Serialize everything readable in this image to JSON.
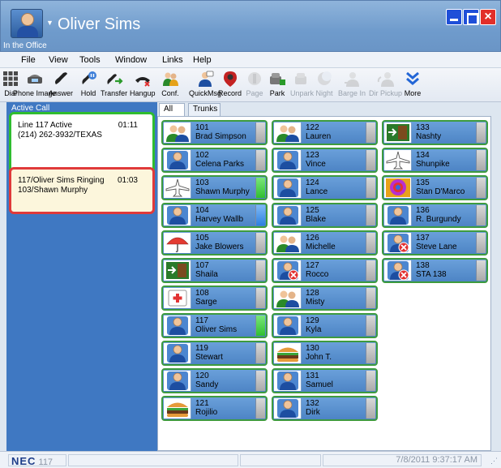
{
  "window": {
    "user_name": "Oliver Sims",
    "presence": "In the Office"
  },
  "menu": [
    "File",
    "View",
    "Tools",
    "Window",
    "Links",
    "Help"
  ],
  "toolbar": [
    {
      "label": "Dial",
      "icon": "dial-icon",
      "enabled": true
    },
    {
      "label": "Phone Image",
      "icon": "phone-image-icon",
      "enabled": true
    },
    {
      "label": "Answer",
      "icon": "answer-icon",
      "enabled": true
    },
    {
      "label": "Hold",
      "icon": "hold-icon",
      "enabled": true
    },
    {
      "label": "Transfer",
      "icon": "transfer-icon",
      "enabled": true
    },
    {
      "label": "Hangup",
      "icon": "hangup-icon",
      "enabled": true
    },
    {
      "label": "Conf.",
      "icon": "conference-icon",
      "enabled": true
    },
    {
      "label": "QuickMsg",
      "icon": "quickmsg-icon",
      "enabled": true
    },
    {
      "label": "Record",
      "icon": "record-icon",
      "enabled": true
    },
    {
      "label": "Page",
      "icon": "page-icon",
      "enabled": false
    },
    {
      "label": "Park",
      "icon": "park-icon",
      "enabled": true
    },
    {
      "label": "Unpark",
      "icon": "unpark-icon",
      "enabled": false
    },
    {
      "label": "Night",
      "icon": "night-icon",
      "enabled": false
    },
    {
      "label": "Barge In",
      "icon": "barge-in-icon",
      "enabled": false
    },
    {
      "label": "Dir Pickup",
      "icon": "dir-pickup-icon",
      "enabled": false
    },
    {
      "label": "More",
      "icon": "more-icon",
      "enabled": true
    }
  ],
  "active_call": {
    "legend": "Active Call",
    "line": "Line 117 Active",
    "number": "(214) 262-3932/TEXAS",
    "time": "01:11"
  },
  "ringing_call": {
    "line": "117/Oliver Sims  Ringing",
    "caller": "103/Shawn Murphy",
    "time": "01:03"
  },
  "tabs": [
    "All",
    "Trunks"
  ],
  "extensions": [
    {
      "num": "101",
      "name": "Brad Simpson",
      "icon": "group-icon",
      "led": "gray"
    },
    {
      "num": "102",
      "name": "Celena Parks",
      "icon": "user-icon",
      "led": "gray"
    },
    {
      "num": "103",
      "name": "Shawn Murphy",
      "icon": "airplane-icon",
      "led": "green"
    },
    {
      "num": "104",
      "name": "Harvey Wallb",
      "icon": "user-icon",
      "led": "blue"
    },
    {
      "num": "105",
      "name": "Jake Blowers",
      "icon": "umbrella-icon",
      "led": "gray"
    },
    {
      "num": "107",
      "name": "Shaila",
      "icon": "exit-door-icon",
      "led": "gray"
    },
    {
      "num": "108",
      "name": "Sarge",
      "icon": "first-aid-icon",
      "led": "gray"
    },
    {
      "num": "117",
      "name": "Oliver Sims",
      "icon": "user-icon",
      "led": "green"
    },
    {
      "num": "119",
      "name": "Stewart",
      "icon": "user-icon",
      "led": "gray"
    },
    {
      "num": "120",
      "name": "Sandy",
      "icon": "user-icon",
      "led": "gray"
    },
    {
      "num": "121",
      "name": "Rojilio",
      "icon": "burger-icon",
      "led": "gray"
    },
    {
      "num": "122",
      "name": "Lauren",
      "icon": "group-icon",
      "led": "gray"
    },
    {
      "num": "123",
      "name": "Vince",
      "icon": "user-icon",
      "led": "gray"
    },
    {
      "num": "124",
      "name": "Lance",
      "icon": "user-icon",
      "led": "gray"
    },
    {
      "num": "125",
      "name": "Blake",
      "icon": "user-icon",
      "led": "gray"
    },
    {
      "num": "126",
      "name": "Michelle",
      "icon": "group-icon",
      "led": "gray"
    },
    {
      "num": "127",
      "name": "Rocco",
      "icon": "user-dnd-icon",
      "led": "gray"
    },
    {
      "num": "128",
      "name": "Misty",
      "icon": "group-icon",
      "led": "gray"
    },
    {
      "num": "129",
      "name": "Kyla",
      "icon": "user-icon",
      "led": "gray"
    },
    {
      "num": "130",
      "name": "John T.",
      "icon": "burger-icon",
      "led": "gray"
    },
    {
      "num": "131",
      "name": "Samuel",
      "icon": "user-icon",
      "led": "gray"
    },
    {
      "num": "132",
      "name": "Dirk",
      "icon": "user-icon",
      "led": "gray"
    },
    {
      "num": "133",
      "name": "Nashty",
      "icon": "exit-door-icon",
      "led": "gray"
    },
    {
      "num": "134",
      "name": "Shunpike",
      "icon": "airplane-icon",
      "led": "gray"
    },
    {
      "num": "135",
      "name": "Stan D'Marco",
      "icon": "burst-icon",
      "led": "gray"
    },
    {
      "num": "136",
      "name": "R. Burgundy",
      "icon": "user-icon",
      "led": "gray"
    },
    {
      "num": "137",
      "name": "Steve Lane",
      "icon": "user-dnd-icon",
      "led": "gray"
    },
    {
      "num": "138",
      "name": "STA 138",
      "icon": "user-dnd-icon",
      "led": "gray"
    }
  ],
  "status": {
    "brand": "NEC",
    "extension": "117",
    "datetime": "7/8/2011 9:37:17 AM"
  },
  "colors": {
    "panel_blue": "#3f78c2",
    "active_border": "#2fbd2f",
    "ringing_border": "#e03a3a",
    "led_green": "#2fbf2f",
    "led_blue": "#2d7fe0"
  }
}
